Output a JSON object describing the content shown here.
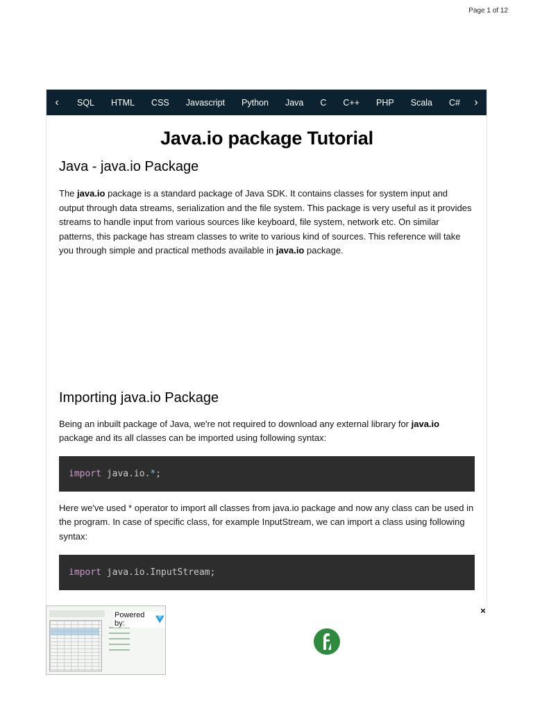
{
  "page_counter": "Page 1 of 12",
  "nav": {
    "prev_icon": "chevron-left-icon",
    "next_icon": "chevron-right-icon",
    "items": [
      "SQL",
      "HTML",
      "CSS",
      "Javascript",
      "Python",
      "Java",
      "C",
      "C++",
      "PHP",
      "Scala",
      "C#"
    ]
  },
  "article": {
    "title": "Java.io package Tutorial",
    "section1": {
      "heading": "Java - java.io Package",
      "para": {
        "t1": "The ",
        "b1": "java.io",
        "t2": " package is a standard package of Java SDK. It contains classes for system input and output through data streams, serialization and the file system. This package is very useful as it provides streams to handle input from various sources like keyboard, file system, network etc. On similar patterns, this package has stream classes to write to various kind of sources. This reference will take you through simple and practical methods available in ",
        "b2": "java.io",
        "t3": " package."
      }
    },
    "section2": {
      "heading": "Importing java.io Package",
      "para1": {
        "t1": "Being an inbuilt package of Java, we're not required to download any external library for ",
        "b1": "java.io",
        "t2": " package and its all classes can be imported using following syntax:"
      },
      "code1": {
        "keyword": "import",
        "body": " java.io.",
        "op": "*",
        "end": ";"
      },
      "para2": "Here we've used * operator to import all classes from java.io package and now any class can be used in the program. In case of specific class, for example InputStream, we can import a class using following syntax:",
      "code2": {
        "keyword": "import",
        "body": " java.io.InputStream;"
      }
    }
  },
  "ad": {
    "powered_by": "Powered by:",
    "close": "×",
    "logo_color": "#2e8b3e",
    "v_icon_color": "#1a9be0"
  }
}
